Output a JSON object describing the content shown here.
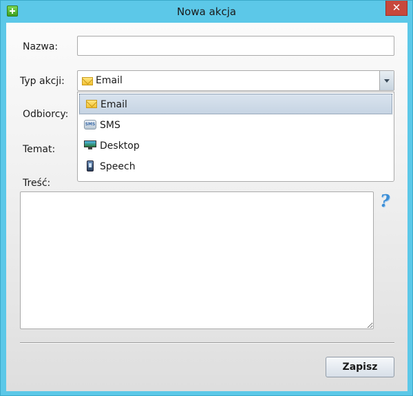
{
  "window": {
    "title": "Nowa akcja",
    "close_label": "✕"
  },
  "form": {
    "name_label": "Nazwa:",
    "name_value": "",
    "type_label": "Typ akcji:",
    "type_value": "Email",
    "recipients_label": "Odbiorcy:",
    "subject_label": "Temat:",
    "body_label": "Treść:",
    "body_value": "",
    "help_glyph": "?"
  },
  "dropdown": {
    "options": [
      {
        "label": "Email",
        "icon": "mail-icon",
        "selected": true
      },
      {
        "label": "SMS",
        "icon": "sms-icon",
        "selected": false
      },
      {
        "label": "Desktop",
        "icon": "desktop-icon",
        "selected": false
      },
      {
        "label": "Speech",
        "icon": "speech-icon",
        "selected": false
      }
    ]
  },
  "footer": {
    "save_label": "Zapisz"
  },
  "colors": {
    "title_bar": "#5cc8e8",
    "close_button": "#c7483c",
    "selection": "#c6d4e3"
  }
}
